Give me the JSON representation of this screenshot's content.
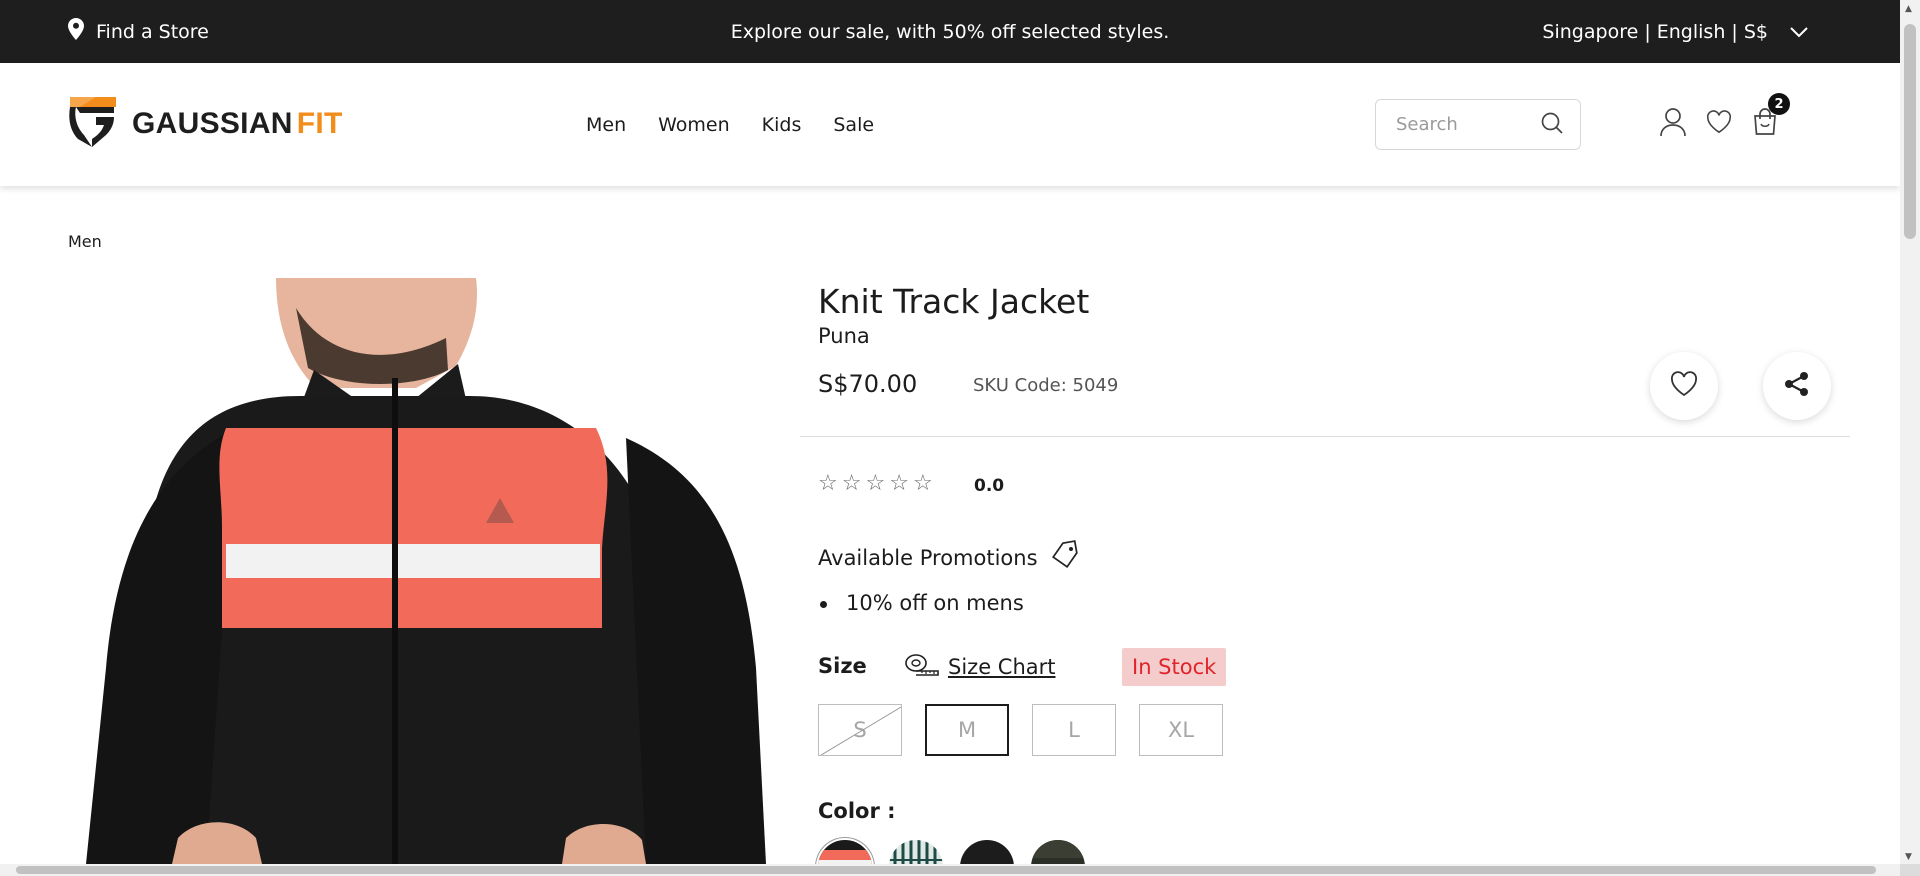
{
  "topbar": {
    "store_label": "Find a Store",
    "promo_text": "Explore our sale, with 50% off selected styles.",
    "locale_label": "Singapore | English | S$"
  },
  "header": {
    "logo_word": "GAUSSIAN",
    "logo_accent": "FIT",
    "nav": [
      "Men",
      "Women",
      "Kids",
      "Sale"
    ],
    "search_placeholder": "Search",
    "cart_count": "2"
  },
  "breadcrumb": "Men",
  "product": {
    "title": "Knit Track Jacket",
    "brand": "Puna",
    "price": "S$70.00",
    "sku": "SKU Code: 5049",
    "rating": "0.0",
    "rating_stars": 0,
    "promotions_heading": "Available Promotions",
    "promotions": [
      "10% off on mens"
    ],
    "size_heading": "Size",
    "size_chart_label": " Size Chart",
    "stock_label": "In Stock",
    "sizes": [
      "S",
      "M",
      "L",
      "XL"
    ],
    "selected_size": "M",
    "unavailable_sizes": [
      "S"
    ],
    "color_heading": "Color :"
  },
  "colors": {
    "accent": "#f28c1a",
    "topbar_bg": "#1e1e1e",
    "stock_bg": "#f4cccc",
    "stock_text": "#e0242b",
    "jacket_orange": "#f26b5a"
  }
}
